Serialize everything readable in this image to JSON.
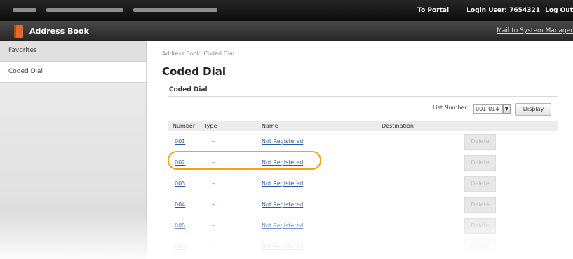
{
  "topbar": {
    "portal_label": "To Portal",
    "login_user": "Login User:  7654321",
    "logout_label": "Log Out"
  },
  "titlebar": {
    "title": "Address Book",
    "mail_link": "Mail to System Manager"
  },
  "sidebar": {
    "items": [
      {
        "label": "Favorites"
      },
      {
        "label": "Coded Dial"
      }
    ]
  },
  "main": {
    "breadcrumb": "Address Book: Coded Dial",
    "page_title": "Coded Dial",
    "section_title": "Coded Dial",
    "list_number_label": "List Number:",
    "list_number_value": "001-014",
    "display_button": "Display",
    "columns": {
      "number": "Number",
      "type": "Type",
      "name": "Name",
      "destination": "Destination"
    },
    "rows": [
      {
        "number": "001",
        "type": "–",
        "name": "Not Registered",
        "delete": "Delete"
      },
      {
        "number": "002",
        "type": "–",
        "name": "Not Registered",
        "delete": "Delete"
      },
      {
        "number": "003",
        "type": "–",
        "name": "Not Registered",
        "delete": "Delete"
      },
      {
        "number": "004",
        "type": "–",
        "name": "Not Registered",
        "delete": "Delete"
      },
      {
        "number": "005",
        "type": "–",
        "name": "Not Registered",
        "delete": "Delete"
      },
      {
        "number": "006",
        "type": "–",
        "name": "Not Registered",
        "delete": "Delete"
      }
    ]
  },
  "colors": {
    "topbar": "#0c0c0c",
    "link": "#2b57a8",
    "highlight": "#f2a31b",
    "book_icon": "#e2692c"
  }
}
